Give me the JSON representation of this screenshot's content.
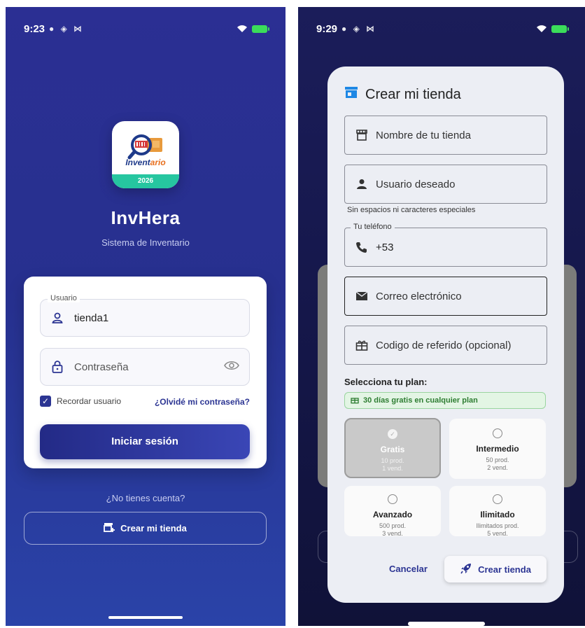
{
  "login_screen": {
    "status": {
      "time": "9:23"
    },
    "logo": {
      "text_part1": "Invent",
      "text_part2": "ario",
      "year": "2026"
    },
    "app_name": "InvHera",
    "app_subtitle": "Sistema de Inventario",
    "username_field": {
      "label": "Usuario",
      "value": "tienda1"
    },
    "password_field": {
      "placeholder": "Contraseña"
    },
    "remember": {
      "label": "Recordar usuario",
      "checked": true
    },
    "forgot_link": "¿Olvidé mi contraseña?",
    "login_button": "Iniciar sesión",
    "no_account_text": "¿No tienes cuenta?",
    "create_store_button": "Crear mi tienda"
  },
  "create_store_dialog": {
    "status": {
      "time": "9:29"
    },
    "title": "Crear mi tienda",
    "fields": {
      "store_name": {
        "placeholder": "Nombre de tu tienda"
      },
      "username": {
        "placeholder": "Usuario deseado",
        "helper": "Sin espacios ni caracteres especiales"
      },
      "phone": {
        "label": "Tu teléfono",
        "value": "+53"
      },
      "email": {
        "placeholder": "Correo electrónico"
      },
      "referral": {
        "placeholder": "Codigo de referido (opcional)"
      }
    },
    "plan_section_title": "Selecciona tu plan:",
    "trial_banner": "30 días gratis en cualquier plan",
    "plans": [
      {
        "name": "Gratis",
        "products": "10 prod.",
        "vendors": "1 vend.",
        "selected": true
      },
      {
        "name": "Intermedio",
        "products": "50 prod.",
        "vendors": "2 vend.",
        "selected": false
      },
      {
        "name": "Avanzado",
        "products": "500 prod.",
        "vendors": "3 vend.",
        "selected": false
      },
      {
        "name": "Ilimitado",
        "products": "Ilimitados prod.",
        "vendors": "5 vend.",
        "selected": false
      }
    ],
    "cancel_button": "Cancelar",
    "create_button": "Crear tienda"
  },
  "colors": {
    "primary": "#2c3593",
    "background_gradient_top": "#2b2f93",
    "accent_green": "#26c6a0"
  }
}
